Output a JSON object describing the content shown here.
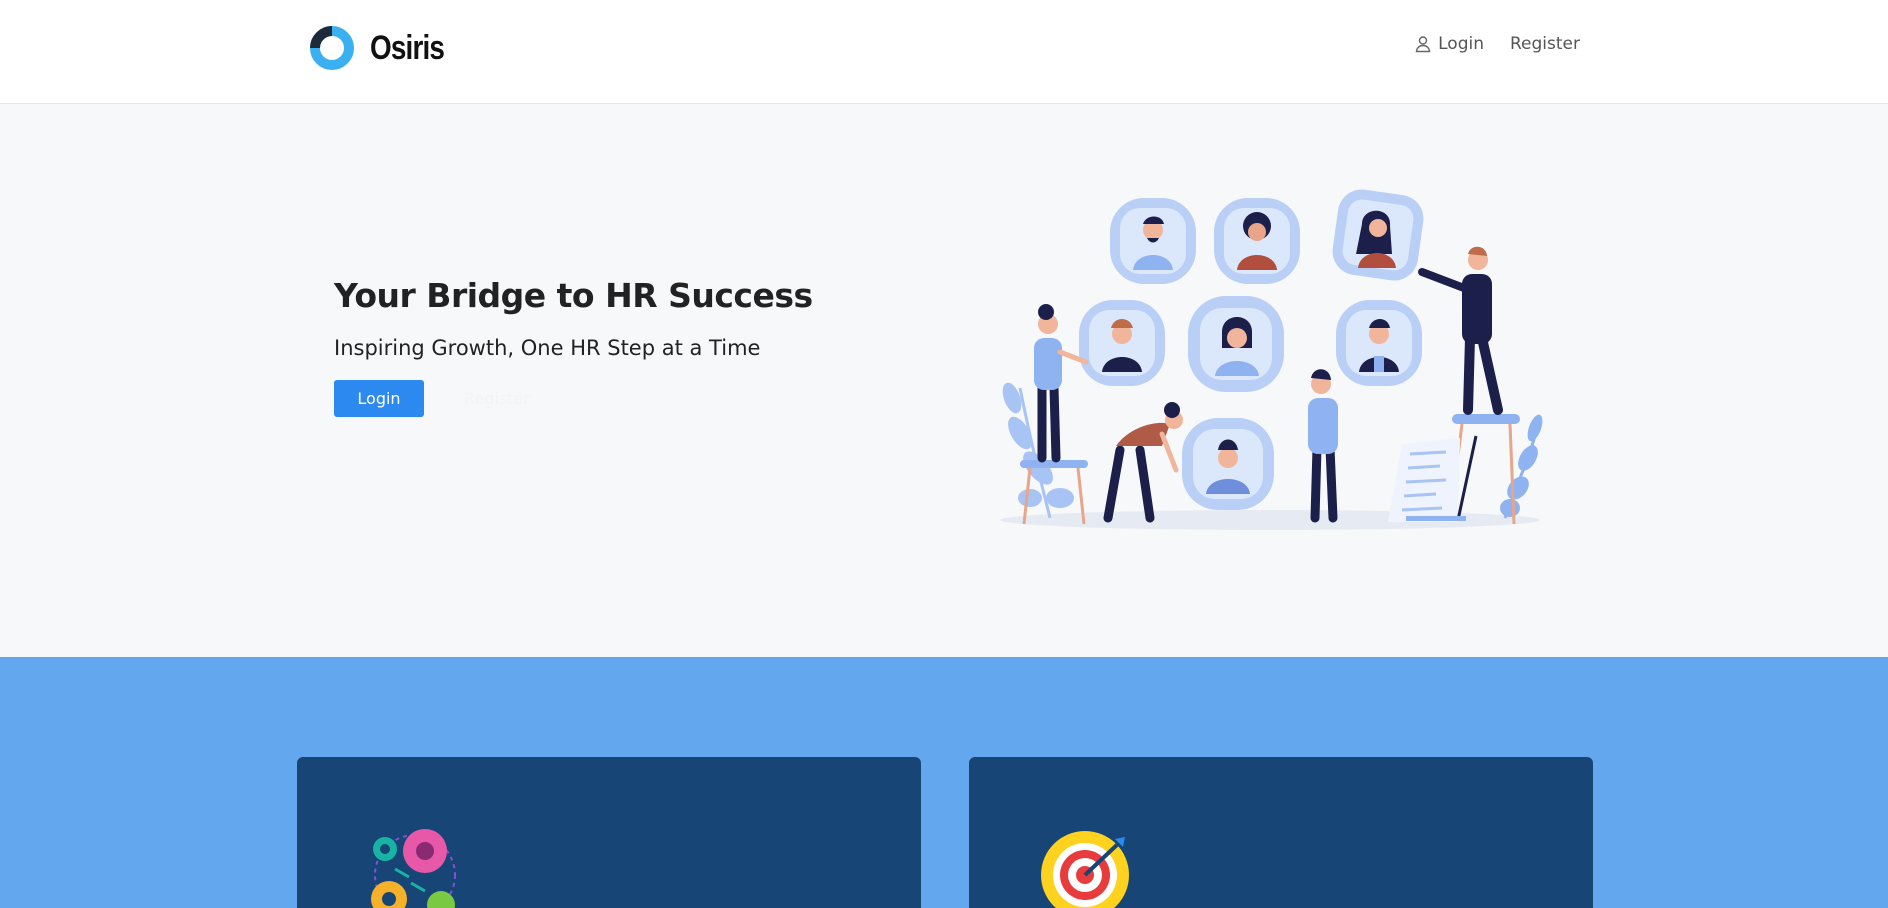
{
  "header": {
    "brand_name": "Osiris",
    "logo_icon": "donut-logo-icon",
    "nav": {
      "login_label": "Login",
      "login_icon": "user-icon",
      "register_label": "Register"
    }
  },
  "hero": {
    "title": "Your Bridge to HR Success",
    "subtitle": "Inspiring Growth, One HR Step at a Time",
    "login_button": "Login",
    "register_button": "Register",
    "illustration": "hr-team-illustration"
  },
  "features": {
    "cards": [
      {
        "icon": "gears-brain-icon"
      },
      {
        "icon": "target-icon"
      }
    ]
  },
  "colors": {
    "accent": "#2b89f0",
    "band": "#63a8ef",
    "card": "#164576",
    "logo_light": "#3bb0f0",
    "logo_dark": "#1d2a3a"
  }
}
